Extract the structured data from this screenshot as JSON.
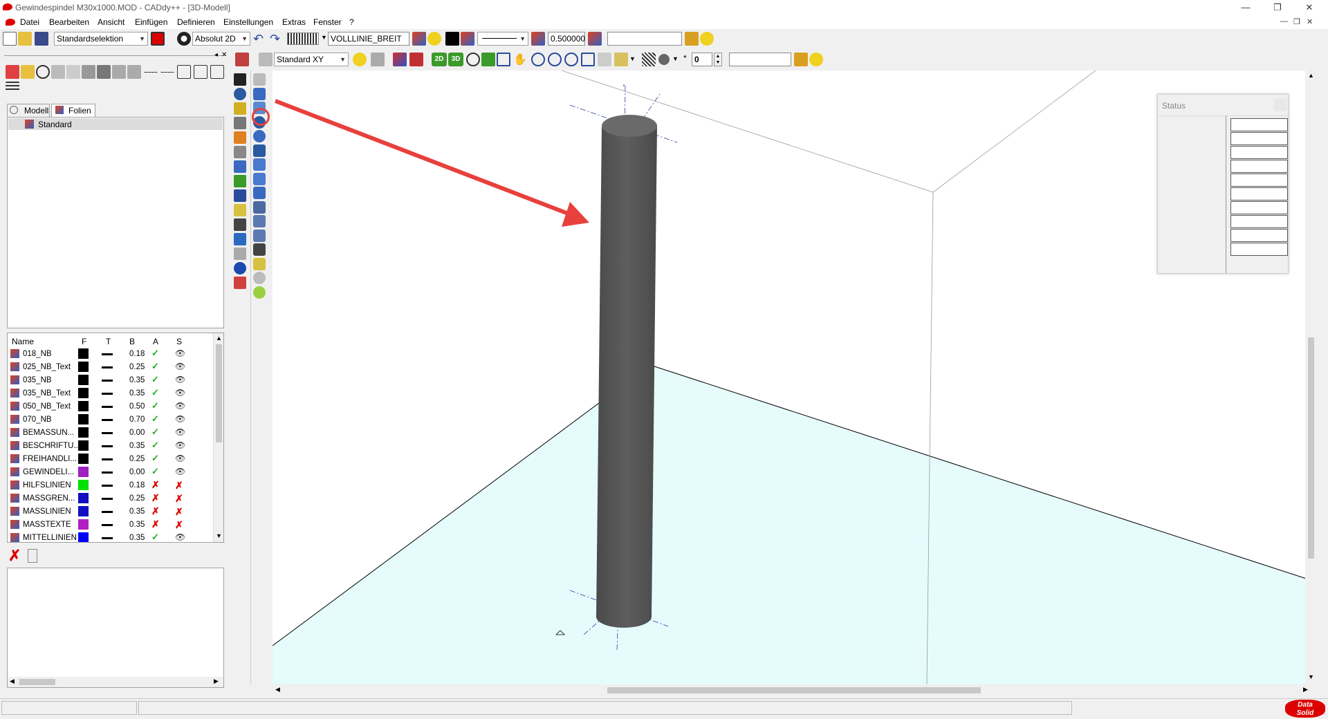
{
  "window": {
    "title": "Gewindespindel M30x1000.MOD  -  CADdy++ - [3D-Modell]",
    "minimize": "—",
    "restore": "❐",
    "close": "✕"
  },
  "menu": [
    "Datei",
    "Bearbeiten",
    "Ansicht",
    "Einfügen",
    "Definieren",
    "Einstellungen",
    "Extras",
    "Fenster",
    "?"
  ],
  "toolbar1": {
    "selection_mode": "Standardselektion",
    "coordinate_mode": "Absolut 2D",
    "line_type": "VOLLLINIE_BREIT",
    "line_width": "0.500000",
    "extra_field": ""
  },
  "toolbar2": {
    "view_plane": "Standard XY",
    "btn_2d": "2D",
    "btn_3d": "3D",
    "counter": "0",
    "extra_field": ""
  },
  "left_panel": {
    "tabs": [
      "Modell",
      "Folien"
    ],
    "active_tab": "Folien",
    "tree_items": [
      "Standard"
    ],
    "table_headers": [
      "Name",
      "F",
      "T",
      "B",
      "A",
      "S"
    ],
    "layers": [
      {
        "name": "018_NB",
        "color": "#000000",
        "width": "0.18",
        "active": true,
        "visible": true
      },
      {
        "name": "025_NB_Text",
        "color": "#000000",
        "width": "0.25",
        "active": true,
        "visible": true
      },
      {
        "name": "035_NB",
        "color": "#000000",
        "width": "0.35",
        "active": true,
        "visible": true
      },
      {
        "name": "035_NB_Text",
        "color": "#000000",
        "width": "0.35",
        "active": true,
        "visible": true
      },
      {
        "name": "050_NB_Text",
        "color": "#000000",
        "width": "0.50",
        "active": true,
        "visible": true
      },
      {
        "name": "070_NB",
        "color": "#000000",
        "width": "0.70",
        "active": true,
        "visible": true
      },
      {
        "name": "BEMASSUN...",
        "color": "#000000",
        "width": "0.00",
        "active": true,
        "visible": true
      },
      {
        "name": "BESCHRIFTU...",
        "color": "#000000",
        "width": "0.35",
        "active": true,
        "visible": true
      },
      {
        "name": "FREIHANDLI...",
        "color": "#000000",
        "width": "0.25",
        "active": true,
        "visible": true
      },
      {
        "name": "GEWINDELI...",
        "color": "#a020c0",
        "width": "0.00",
        "active": true,
        "visible": true
      },
      {
        "name": "HILFSLINIEN",
        "color": "#00e000",
        "width": "0.18",
        "active": false,
        "visible": false
      },
      {
        "name": "MASSGREN...",
        "color": "#1010c0",
        "width": "0.25",
        "active": false,
        "visible": false
      },
      {
        "name": "MASSLINIEN",
        "color": "#1010c0",
        "width": "0.35",
        "active": false,
        "visible": false
      },
      {
        "name": "MASSTEXTE",
        "color": "#b020c0",
        "width": "0.35",
        "active": false,
        "visible": false
      },
      {
        "name": "MITTELLINIEN",
        "color": "#0000ff",
        "width": "0.35",
        "active": true,
        "visible": true
      }
    ]
  },
  "status_window": {
    "title": "Status",
    "cells": [
      "",
      "",
      "",
      "",
      "",
      "",
      "",
      "",
      "",
      ""
    ]
  },
  "brand": {
    "line1": "Data",
    "line2": "Solid"
  },
  "colors": {
    "accent_red": "#e8403c",
    "floor": "#e6fbfc",
    "cylinder": "#5a5a5a"
  }
}
